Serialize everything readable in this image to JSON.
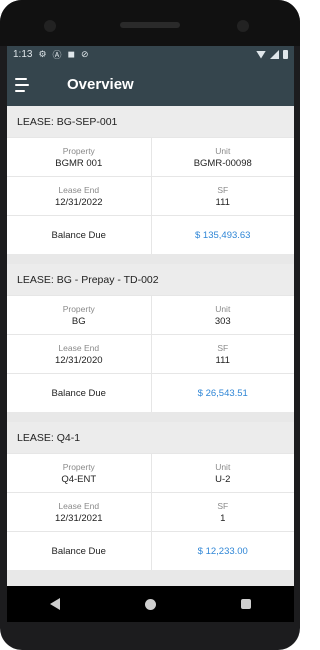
{
  "status_bar": {
    "time": "1:13",
    "icons": [
      "settings-icon",
      "a-icon",
      "shield-icon",
      "circle-icon"
    ]
  },
  "app_bar": {
    "title": "Overview"
  },
  "leases": [
    {
      "header": "LEASE: BG-SEP-001",
      "property_label": "Property",
      "property": "BGMR 001",
      "unit_label": "Unit",
      "unit": "BGMR-00098",
      "lease_end_label": "Lease End",
      "lease_end": "12/31/2022",
      "sf_label": "SF",
      "sf": "111",
      "balance_label": "Balance Due",
      "balance": "$ 135,493.63"
    },
    {
      "header": "LEASE: BG - Prepay - TD-002",
      "property_label": "Property",
      "property": "BG",
      "unit_label": "Unit",
      "unit": "303",
      "lease_end_label": "Lease End",
      "lease_end": "12/31/2020",
      "sf_label": "SF",
      "sf": "111",
      "balance_label": "Balance Due",
      "balance": "$ 26,543.51"
    },
    {
      "header": "LEASE: Q4-1",
      "property_label": "Property",
      "property": "Q4-ENT",
      "unit_label": "Unit",
      "unit": "U-2",
      "lease_end_label": "Lease End",
      "lease_end": "12/31/2021",
      "sf_label": "SF",
      "sf": "1",
      "balance_label": "Balance Due",
      "balance": "$ 12,233.00"
    }
  ],
  "colors": {
    "app_bar": "#35454d",
    "link": "#2f86d6",
    "header_bg": "#ececec"
  }
}
